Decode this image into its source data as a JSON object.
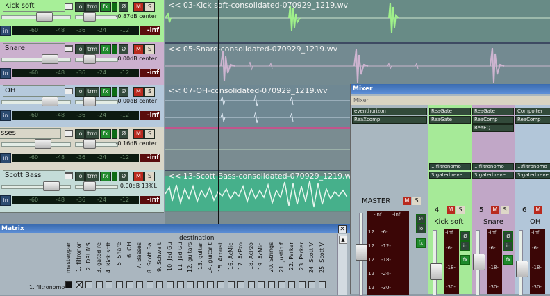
{
  "tracks": [
    {
      "name": "Kick soft",
      "volume": "-0.87dB center",
      "peak": "-inf",
      "bg": "#a7ef98",
      "clip": "<< 03-Kick soft-consolidated-070929_1219.wv"
    },
    {
      "name": "Snare",
      "volume": "0.00dB center",
      "peak": "-inf",
      "bg": "#cbb0ce",
      "clip": "<< 05-Snare-consolidated-070929_1219.wv"
    },
    {
      "name": "OH",
      "volume": "0.00dB center",
      "peak": "-inf",
      "bg": "#b5c9dc",
      "clip": "<< 07-OH-consolidated-070929_1219.wv"
    },
    {
      "name": "sses",
      "volume": "-0.16dB center",
      "peak": "-inf",
      "bg": "#d9d6c8",
      "clip": ""
    },
    {
      "name": "Scott Bass",
      "volume": "0.00dB 13%L",
      "peak": "-inf",
      "bg": "#c4dcd8",
      "clip": "<< 13-Scott Bass-consolidated-070929_1219.wv"
    }
  ],
  "tcp": {
    "io": "io",
    "trim": "trm",
    "fx": "fx",
    "phase": "Ø",
    "mute": "M",
    "solo": "S",
    "input": "in"
  },
  "meter_scale": [
    "-60",
    "-48",
    "-36",
    "-24",
    "-12"
  ],
  "mixer": {
    "title": "Mixer",
    "tab": "Mixer",
    "master_label": "MASTER",
    "master_fx": [
      "eventhorizon",
      "ReaXcomp"
    ],
    "master_peaks": [
      "-inf",
      "-inf"
    ],
    "scale": [
      "-6-",
      "-12-",
      "-18-",
      "-24-",
      "-30-"
    ],
    "scale_left": [
      "12",
      "12",
      "12",
      "12",
      "12"
    ],
    "channels": [
      {
        "num": "4",
        "name": "Kick soft",
        "bg": "#a6ea98",
        "fx": [
          "ReaGate",
          "ReaGate"
        ],
        "sends": [
          "1:filtronomo",
          "3:gated reve"
        ],
        "peak": "-inf"
      },
      {
        "num": "5",
        "name": "Snare",
        "bg": "#c1a7c7",
        "fx": [
          "ReaGate",
          "ReaComp",
          "ReaEQ"
        ],
        "sends": [
          "1:filtronomo",
          "3:gated reve"
        ],
        "peak": "-inf"
      },
      {
        "num": "6",
        "name": "OH",
        "bg": "#b2c6d9",
        "fx": [
          "Compoiter",
          "ReaComp"
        ],
        "sends": [
          "1:filtronomo",
          "3:gated reve"
        ],
        "peak": "-inf"
      }
    ],
    "io_label": "io",
    "fx_label": "fx",
    "phase": "Ø",
    "mute": "M",
    "solo": "S"
  },
  "matrix": {
    "title": "Matrix",
    "header": "destination",
    "row_label": "1. filtronomo",
    "destinations": [
      "master/par",
      "1. filtronor",
      "2. DRUMS",
      "3. gated re",
      "4. Kick soft",
      "5. Snare",
      "6. OH",
      "7. Basses",
      "8. Scott Ba",
      "9. Schwa t",
      "10. Jed Gu",
      "11. Jed Gu",
      "12. guitars",
      "13. guitar",
      "14. guitar t",
      "15. Acoust",
      "16. AcMic",
      "17. AcPzo",
      "18. AcPzo",
      "19. AcMic",
      "20. Strings",
      "21. Justin f",
      "22. Parker",
      "23. Parker",
      "24. Scott V",
      "25. Scott V"
    ]
  }
}
